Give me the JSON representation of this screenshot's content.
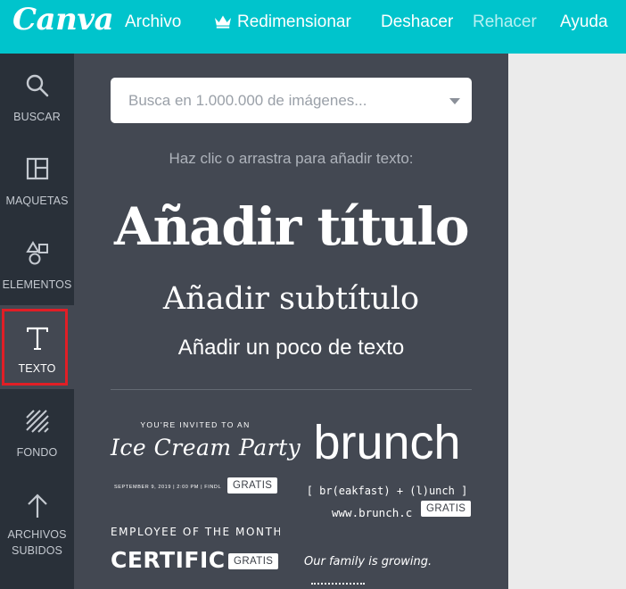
{
  "app": {
    "logo": "Canva"
  },
  "topbar": {
    "menu": [
      "Archivo",
      "Redimensionar",
      "Deshacer",
      "Rehacer",
      "Ayuda"
    ]
  },
  "sidebar": {
    "items": [
      {
        "label": "BUSCAR",
        "icon": "search-icon"
      },
      {
        "label": "MAQUETAS",
        "icon": "layout-icon"
      },
      {
        "label": "ELEMENTOS",
        "icon": "shapes-icon"
      },
      {
        "label": "TEXTO",
        "icon": "text-icon",
        "active": true
      },
      {
        "label": "FONDO",
        "icon": "background-icon"
      },
      {
        "label_line1": "ARCHIVOS",
        "label_line2": "SUBIDOS",
        "icon": "upload-icon"
      }
    ]
  },
  "panel": {
    "search_placeholder": "Busca en 1.000.000 de imágenes...",
    "hint": "Haz clic o arrastra para añadir texto:",
    "add_title": "Añadir título",
    "add_subtitle": "Añadir subtítulo",
    "add_body": "Añadir un poco de texto",
    "templates": [
      {
        "line1": "YOU'RE INVITED TO AN",
        "line2": "Ice Cream Party",
        "line3": "SEPTEMBER 9, 2019 | 2:00 PM | FINDL",
        "badge": "GRATIS"
      },
      {
        "line1": "brunch",
        "line2": "[ br(eakfast) + (l)unch ]",
        "line3": "www.brunch.c",
        "badge": "GRATIS"
      },
      {
        "line1": "EMPLOYEE OF THE MONTH",
        "line2": "CERTIFIC",
        "badge": "GRATIS"
      },
      {
        "line1": "Our family is growing."
      }
    ]
  },
  "colors": {
    "topbar": "#00c4cc",
    "rail": "#293039",
    "panel": "#434852",
    "highlight": "#e11e26"
  }
}
